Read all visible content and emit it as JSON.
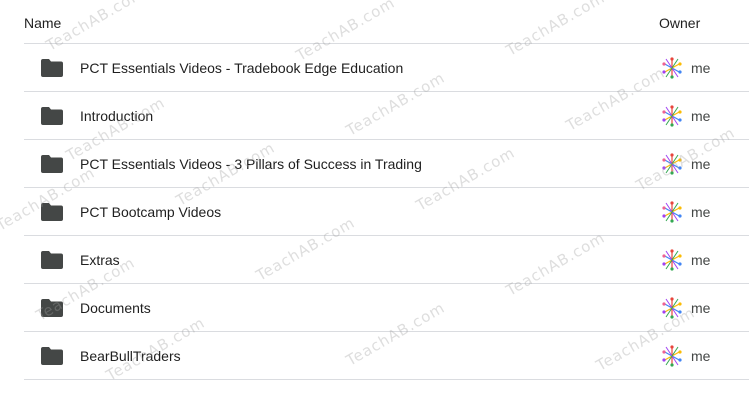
{
  "header": {
    "name_label": "Name",
    "owner_label": "Owner"
  },
  "rows": [
    {
      "name": "PCT Essentials Videos - Tradebook Edge Education",
      "owner": "me",
      "icon": "folder-icon"
    },
    {
      "name": "Introduction",
      "owner": "me",
      "icon": "folder-icon"
    },
    {
      "name": "PCT Essentials Videos - 3 Pillars of Success in Trading",
      "owner": "me",
      "icon": "folder-icon"
    },
    {
      "name": "PCT Bootcamp Videos",
      "owner": "me",
      "icon": "folder-icon"
    },
    {
      "name": "Extras",
      "owner": "me",
      "icon": "folder-icon"
    },
    {
      "name": "Documents",
      "owner": "me",
      "icon": "folder-icon"
    },
    {
      "name": "BearBullTraders",
      "owner": "me",
      "icon": "folder-icon"
    }
  ],
  "watermark_text": "TeachAB.com",
  "colors": {
    "folder": "#444746",
    "divider": "#dadce0",
    "text": "#1f1f1f"
  }
}
